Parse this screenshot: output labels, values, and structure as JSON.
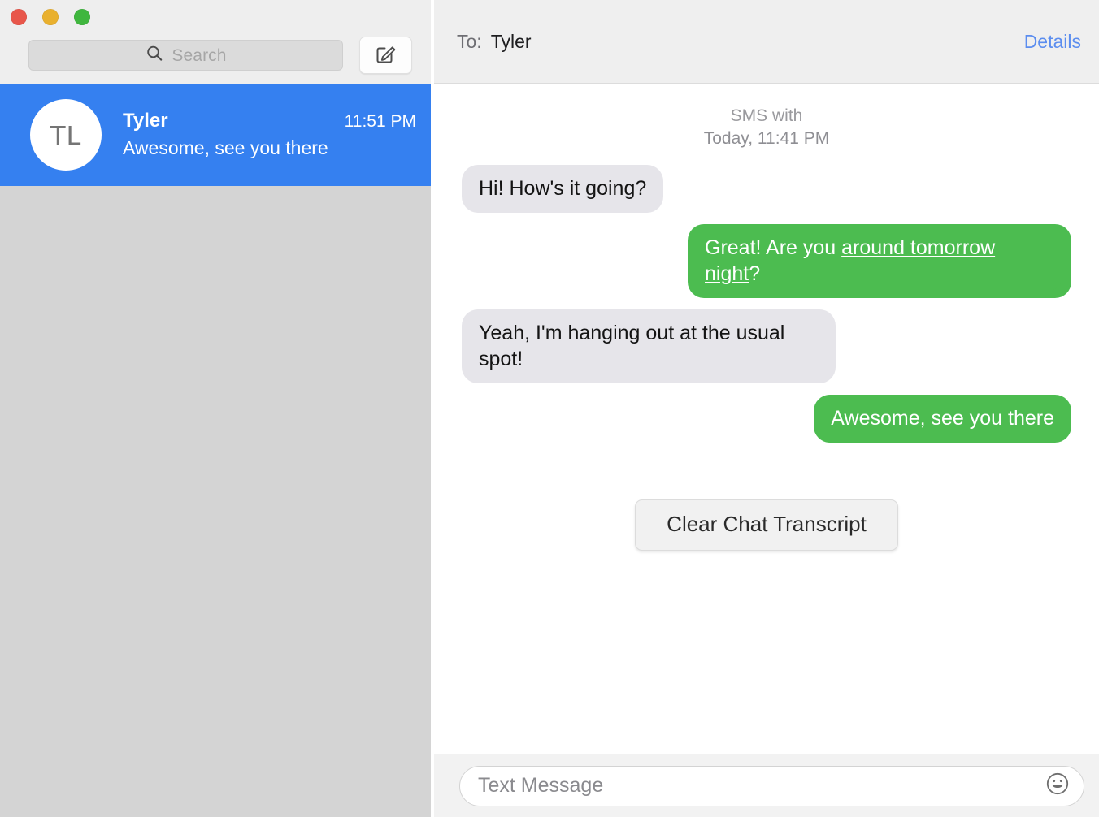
{
  "window": {
    "traffic_lights": [
      {
        "name": "close",
        "color": "#e8564a"
      },
      {
        "name": "minimize",
        "color": "#e9b02e"
      },
      {
        "name": "maximize",
        "color": "#3fb63e"
      }
    ]
  },
  "sidebar": {
    "search": {
      "placeholder": "Search",
      "value": "",
      "icon": "search-icon"
    },
    "compose_button": {
      "icon": "compose-icon",
      "label": ""
    },
    "conversations": [
      {
        "avatar_initials": "TL",
        "name": "Tyler",
        "time": "11:51 PM",
        "preview": "Awesome, see you there",
        "selected": true,
        "selected_color": "#3580f0"
      }
    ]
  },
  "conversation": {
    "header": {
      "to_label": "To:",
      "recipient": "Tyler",
      "details_label": "Details",
      "details_color": "#5b8def"
    },
    "transcript_header": {
      "line1": "SMS with",
      "line2": "Today, 11:41 PM"
    },
    "messages": [
      {
        "direction": "incoming",
        "text": "Hi! How's it going?",
        "bubble_color": "#e6e5ea",
        "text_color": "#141414"
      },
      {
        "direction": "outgoing",
        "text_before_link": "Great! Are you ",
        "link_text": "around tomorrow night",
        "text_after_link": "?",
        "text": "Great! Are you around tomorrow night?",
        "bubble_color": "#4cbc50",
        "text_color": "#ffffff"
      },
      {
        "direction": "incoming",
        "text": "Yeah, I'm hanging out at the usual spot!",
        "bubble_color": "#e6e5ea",
        "text_color": "#141414"
      },
      {
        "direction": "outgoing",
        "text": "Awesome, see you there",
        "bubble_color": "#4cbc50",
        "text_color": "#ffffff"
      }
    ],
    "clear_transcript_button": "Clear Chat Transcript",
    "compose": {
      "placeholder": "Text Message",
      "value": "",
      "emoji_icon": "smiley-face-icon"
    }
  }
}
